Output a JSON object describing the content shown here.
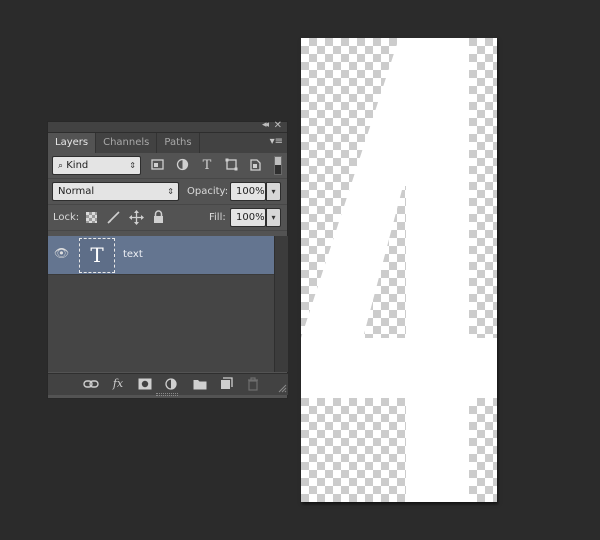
{
  "panel": {
    "collapse_icon": "double-chevron-icon",
    "close_glyph": "✕",
    "tabs": [
      {
        "label": "Layers",
        "active": true
      },
      {
        "label": "Channels",
        "active": false
      },
      {
        "label": "Paths",
        "active": false
      }
    ],
    "menu_glyph": "▾≡",
    "filter": {
      "kind_label": "Kind",
      "icons": [
        "pixel-filter-icon",
        "adjustment-filter-icon",
        "type-filter-icon",
        "shape-filter-icon",
        "smart-object-filter-icon"
      ]
    },
    "blend_mode": "Normal",
    "opacity_label": "Opacity:",
    "opacity_value": "100%",
    "lock_label": "Lock:",
    "fill_label": "Fill:",
    "fill_value": "100%",
    "layers": [
      {
        "name": "text",
        "type": "text",
        "thumb_glyph": "T",
        "visible": true,
        "selected": true
      }
    ],
    "bottom_icons": [
      "link-icon",
      "fx-icon",
      "mask-icon",
      "adjustment-icon",
      "folder-icon",
      "new-layer-icon",
      "trash-icon"
    ],
    "fx_label": "fx"
  },
  "canvas": {
    "content": "4",
    "background": "transparent-checkerboard",
    "glyph_color": "#ffffff"
  },
  "colors": {
    "app_bg": "#2b2b2b",
    "panel_bg": "#535353",
    "selected_layer": "#647590"
  }
}
